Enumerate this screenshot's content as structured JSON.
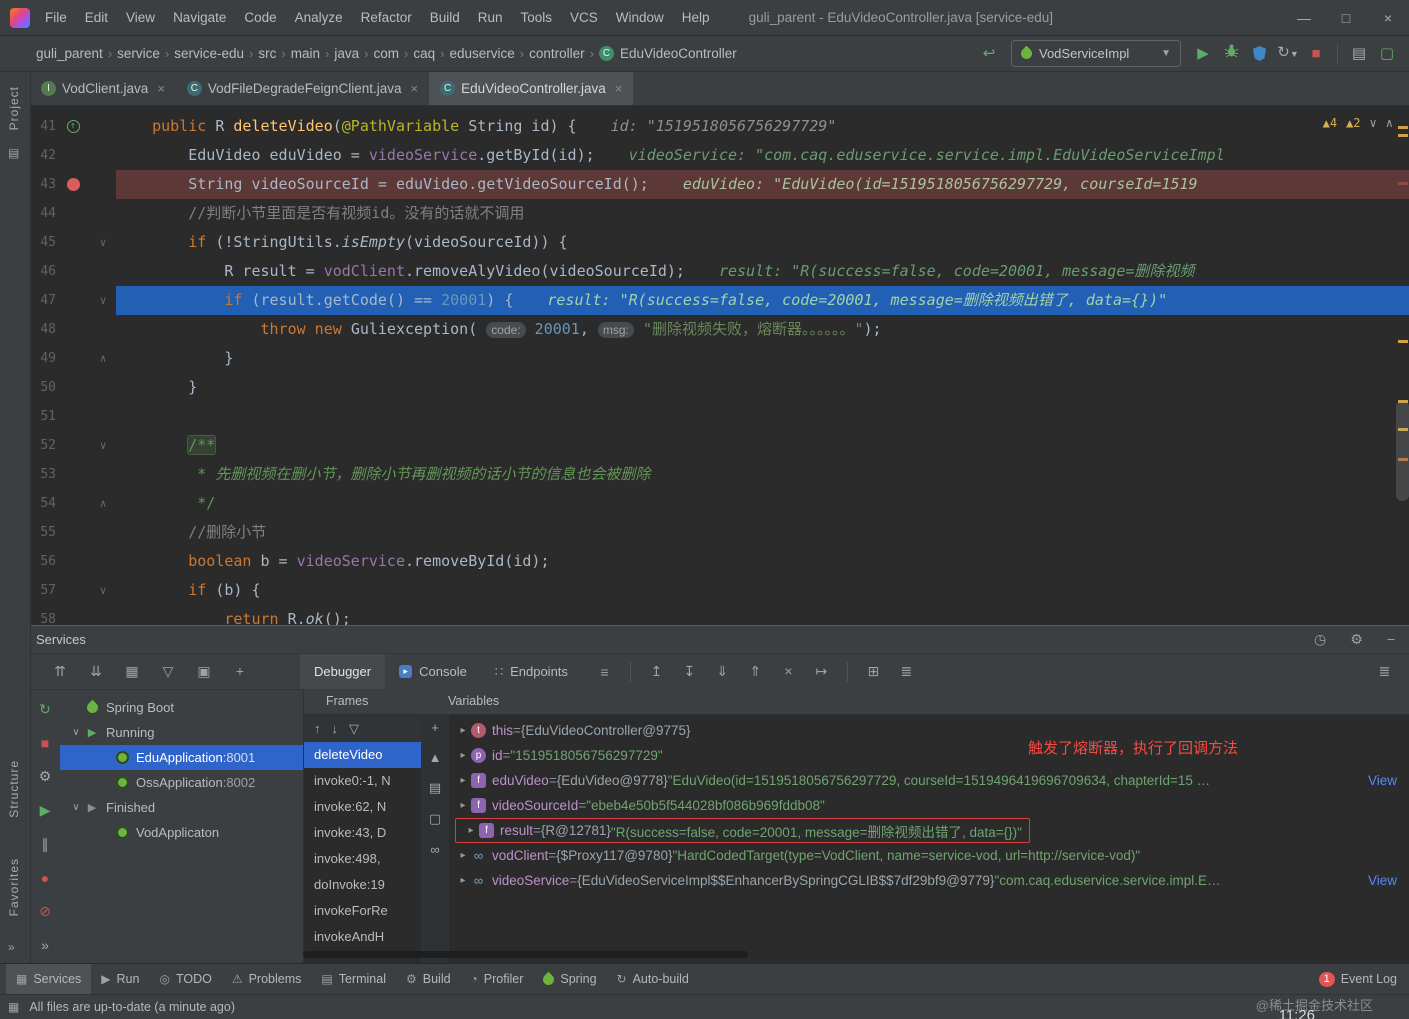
{
  "titlebar": {
    "menus": [
      "File",
      "Edit",
      "View",
      "Navigate",
      "Code",
      "Analyze",
      "Refactor",
      "Build",
      "Run",
      "Tools",
      "VCS",
      "Window",
      "Help"
    ],
    "title": "guli_parent - EduVideoController.java [service-edu]"
  },
  "navbar": {
    "breadcrumbs": [
      "guli_parent",
      "service",
      "service-edu",
      "src",
      "main",
      "java",
      "com",
      "caq",
      "eduservice",
      "controller",
      "EduVideoController"
    ],
    "run_config": "VodServiceImpl"
  },
  "tabs": [
    {
      "label": "VodClient.java",
      "kind": "I"
    },
    {
      "label": "VodFileDegradeFeignClient.java",
      "kind": "C"
    },
    {
      "label": "EduVideoController.java",
      "kind": "C",
      "active": true
    }
  ],
  "editor": {
    "inspections": {
      "warnings": "4",
      "weak": "2"
    },
    "lines": [
      {
        "num": "41",
        "icon": "override",
        "tokens": [
          [
            "k",
            "    public "
          ],
          [
            "p",
            "R "
          ],
          [
            "m",
            "deleteVideo"
          ],
          [
            "p",
            "("
          ],
          [
            "a",
            "@PathVariable "
          ],
          [
            "p",
            "String id) {"
          ]
        ],
        "hint": "id: \"1519518056756297729\"",
        "hint_gray": true
      },
      {
        "num": "42",
        "tokens": [
          [
            "p",
            "        EduVideo eduVideo = "
          ],
          [
            "f",
            "videoService"
          ],
          [
            "p",
            ".getById(id);"
          ]
        ],
        "hint": "videoService: \"com.caq.eduservice.service.impl.EduVideoServiceImpl"
      },
      {
        "num": "43",
        "icon": "breakpoint",
        "bg": "break",
        "tokens": [
          [
            "p",
            "        String videoSourceId = eduVideo.getVideoSourceId();"
          ]
        ],
        "hint": "eduVideo: \"EduVideo(id=1519518056756297729, courseId=1519"
      },
      {
        "num": "44",
        "tokens": [
          [
            "c",
            "        //判断小节里面是否有视频id。没有的话就不调用"
          ]
        ]
      },
      {
        "num": "45",
        "fold": "d",
        "tokens": [
          [
            "p",
            "        "
          ],
          [
            "k",
            "if "
          ],
          [
            "p",
            "(!StringUtils."
          ],
          [
            "i",
            "isEmpty"
          ],
          [
            "p",
            "(videoSourceId)) {"
          ]
        ]
      },
      {
        "num": "46",
        "tokens": [
          [
            "p",
            "            R result = "
          ],
          [
            "f",
            "vodClient"
          ],
          [
            "p",
            ".removeAlyVideo(videoSourceId);"
          ]
        ],
        "hint": "result: \"R(success=false, code=20001, message=删除视频"
      },
      {
        "num": "47",
        "fold": "d",
        "bg": "exec",
        "tokens": [
          [
            "p",
            "            "
          ],
          [
            "k",
            "if "
          ],
          [
            "p",
            "(result.getCode() == "
          ],
          [
            "n",
            "20001"
          ],
          [
            "p",
            ") {"
          ]
        ],
        "hint": "result: \"R(success=false, code=20001, message=删除视频出错了, data={})\""
      },
      {
        "num": "48",
        "tokens": [
          [
            "p",
            "                "
          ],
          [
            "k",
            "throw new "
          ],
          [
            "p",
            "Guliexception( "
          ],
          [
            "h",
            "code:"
          ],
          [
            "p",
            " "
          ],
          [
            "n",
            "20001"
          ],
          [
            "p",
            ", "
          ],
          [
            "h",
            "msg:"
          ],
          [
            "p",
            " "
          ],
          [
            "s",
            "\"删除视频失败，熔断器。。。。。。\""
          ],
          [
            "p",
            ");"
          ]
        ]
      },
      {
        "num": "49",
        "fold": "u",
        "tokens": [
          [
            "p",
            "            }"
          ]
        ]
      },
      {
        "num": "50",
        "tokens": [
          [
            "p",
            "        }"
          ]
        ]
      },
      {
        "num": "51",
        "tokens": []
      },
      {
        "num": "52",
        "fold": "d",
        "tokens": [
          [
            "p",
            "        "
          ],
          [
            "db",
            "/**"
          ]
        ]
      },
      {
        "num": "53",
        "tokens": [
          [
            "p",
            "        "
          ],
          [
            "di",
            " * 先删视频在删小节，删除小节再删视频的话小节的信息也会被删除"
          ]
        ]
      },
      {
        "num": "54",
        "fold": "u",
        "tokens": [
          [
            "p",
            "        "
          ],
          [
            "d",
            " */"
          ]
        ]
      },
      {
        "num": "55",
        "tokens": [
          [
            "c",
            "        //删除小节"
          ]
        ]
      },
      {
        "num": "56",
        "tokens": [
          [
            "p",
            "        "
          ],
          [
            "k",
            "boolean "
          ],
          [
            "p",
            "b = "
          ],
          [
            "f",
            "videoService"
          ],
          [
            "p",
            ".removeById(id);"
          ]
        ]
      },
      {
        "num": "57",
        "fold": "d",
        "tokens": [
          [
            "p",
            "        "
          ],
          [
            "k",
            "if "
          ],
          [
            "p",
            "(b) {"
          ]
        ]
      },
      {
        "num": "58",
        "tokens": [
          [
            "p",
            "            "
          ],
          [
            "k",
            "return "
          ],
          [
            "p",
            "R."
          ],
          [
            "i",
            "ok"
          ],
          [
            "p",
            "();"
          ]
        ]
      }
    ]
  },
  "services": {
    "title": "Services",
    "toolbar_left": [
      {
        "n": "refresh",
        "c": "green"
      },
      {
        "n": "expand-all",
        "c": "gray"
      },
      {
        "n": "collapse-all",
        "c": "gray"
      },
      {
        "n": "group",
        "c": "gray"
      },
      {
        "n": "filter",
        "c": "gray"
      },
      {
        "n": "preview",
        "c": "gray"
      },
      {
        "n": "add",
        "c": "gray"
      }
    ],
    "debug_tabs": [
      {
        "label": "Debugger",
        "active": true
      },
      {
        "label": "Console",
        "icon": "console"
      },
      {
        "label": "Endpoints",
        "icon": "endpoints"
      }
    ],
    "debug_actions_a": [
      {
        "n": "layout",
        "c": "gray"
      }
    ],
    "debug_actions_b": [
      {
        "n": "update-app",
        "c": "gray"
      },
      {
        "n": "dump",
        "c": "gray"
      },
      {
        "n": "attach",
        "c": "gray"
      },
      {
        "n": "detach",
        "c": "gray"
      },
      {
        "n": "drop-frame",
        "c": "gray"
      },
      {
        "n": "restore",
        "c": "gray"
      }
    ],
    "debug_actions_c": [
      {
        "n": "grid",
        "c": "gray"
      },
      {
        "n": "rows",
        "c": "gray"
      }
    ],
    "vtoolbar": [
      {
        "n": "rerun",
        "c": "green"
      },
      {
        "n": "stop",
        "c": "red"
      },
      {
        "n": "build",
        "c": "gray"
      },
      {
        "n": "resume",
        "c": "green"
      },
      {
        "n": "pause",
        "c": "gray"
      },
      {
        "n": "stop-circle",
        "c": "red"
      },
      {
        "n": "mute-breakpoints",
        "c": "red"
      },
      {
        "n": "more",
        "c": "gray"
      }
    ],
    "tree": [
      {
        "label": "Spring Boot",
        "icon": "spring",
        "level": 0,
        "chevron": false
      },
      {
        "label": "Running",
        "icon": "run",
        "level": 0,
        "chevron": true
      },
      {
        "label": "EduApplication",
        "port": " :8001",
        "icon": "boot",
        "level": 1,
        "selected": true
      },
      {
        "label": "OssApplication",
        "port": " :8002",
        "icon": "boot",
        "level": 1
      },
      {
        "label": "Finished",
        "icon": "finished",
        "level": 0,
        "chevron": true
      },
      {
        "label": "VodApplicaton",
        "port": "",
        "icon": "boot",
        "level": 1
      }
    ],
    "frames_label": "Frames",
    "variables_label": "Variables",
    "frames_tools": [
      {
        "n": "up",
        "c": "gray"
      },
      {
        "n": "down",
        "c": "gray"
      },
      {
        "n": "filter",
        "c": "gray"
      }
    ],
    "strip_icons": [
      {
        "n": "add",
        "c": "gray"
      },
      {
        "n": "scroll-up",
        "c": "gray"
      },
      {
        "n": "copy",
        "c": "gray"
      },
      {
        "n": "snapshot",
        "c": "gray"
      },
      {
        "n": "watch",
        "c": "gray"
      }
    ],
    "frames": [
      "deleteVideo",
      "invoke0:-1, N",
      "invoke:62, N",
      "invoke:43, D",
      "invoke:498, ",
      "doInvoke:19",
      "invokeForRe",
      "invokeAndH"
    ],
    "variables": [
      {
        "icon": "this",
        "name": "this",
        "value_ref": "{EduVideoController@9775}",
        "value_str": ""
      },
      {
        "icon": "param",
        "name": "id",
        "value_ref": "",
        "value_str": "\"1519518056756297729\""
      },
      {
        "icon": "field",
        "name": "eduVideo",
        "value_ref": "{EduVideo@9778}",
        "value_str": "\"EduVideo(id=1519518056756297729, courseId=1519496419696709634, chapterId=15 …",
        "link": "View"
      },
      {
        "icon": "field",
        "name": "videoSourceId",
        "value_ref": "",
        "value_str": "\"ebeb4e50b5f544028bf086b969fddb08\""
      },
      {
        "icon": "field",
        "name": "result",
        "value_ref": "{R@12781}",
        "value_str": "\"R(success=false, code=20001, message=删除视频出错了, data={})\"",
        "boxed": true
      },
      {
        "icon": "oo",
        "name": "vodClient",
        "value_ref": "{$Proxy117@9780}",
        "value_str": "\"HardCodedTarget(type=VodClient, name=service-vod, url=http://service-vod)\""
      },
      {
        "icon": "oo",
        "name": "videoService",
        "value_ref": "{EduVideoServiceImpl$$EnhancerBySpringCGLIB$$7df29bf9@9779}",
        "value_str": "\"com.caq.eduservice.service.impl.E…",
        "link": "View"
      }
    ],
    "annotation": "触发了熔断器，执行了回调方法"
  },
  "stripe": {
    "top": "Project",
    "mid": "Structure",
    "bottom": "Favorites"
  },
  "statusbar": {
    "items": [
      {
        "label": "Services",
        "active": true
      },
      {
        "label": "Run"
      },
      {
        "label": "TODO"
      },
      {
        "label": "Problems"
      },
      {
        "label": "Terminal"
      },
      {
        "label": "Build"
      },
      {
        "label": "Profiler"
      },
      {
        "label": "Spring"
      },
      {
        "label": "Auto-build"
      }
    ],
    "event_badge": "1",
    "event_log": "Event Log"
  },
  "statusline": {
    "message": "All files are up-to-date (a minute ago)",
    "watermark": "@稀土掘金技术社区",
    "time": "11:26"
  }
}
